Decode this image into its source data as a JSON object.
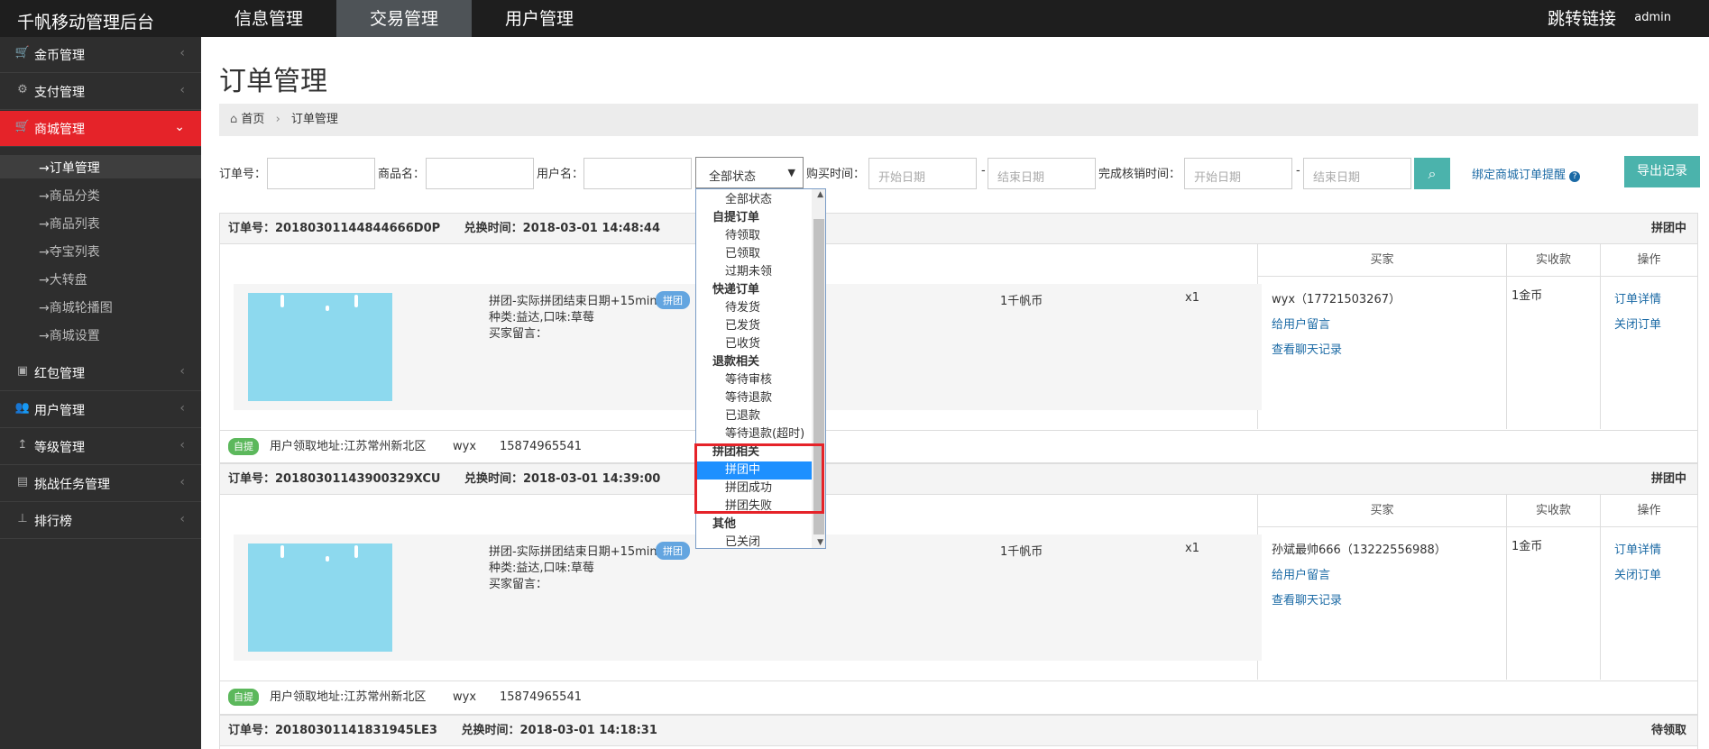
{
  "topbar": {
    "brand": "千帆移动管理后台",
    "nav": [
      "信息管理",
      "交易管理",
      "用户管理"
    ],
    "jump_link": "跳转链接",
    "user": "admin"
  },
  "sidebar": {
    "items": [
      {
        "label": "金币管理"
      },
      {
        "label": "支付管理"
      },
      {
        "label": "商城管理"
      },
      {
        "label": "红包管理"
      },
      {
        "label": "用户管理"
      },
      {
        "label": "等级管理"
      },
      {
        "label": "挑战任务管理"
      },
      {
        "label": "排行榜"
      }
    ],
    "sub_items": [
      "→订单管理",
      "→商品分类",
      "→商品列表",
      "→夺宝列表",
      "→大转盘",
      "→商城轮播图",
      "→商城设置"
    ]
  },
  "page": {
    "title": "订单管理",
    "breadcrumb_home": "首页",
    "breadcrumb_sep": "›",
    "breadcrumb_current": "订单管理"
  },
  "filters": {
    "order_no_label": "订单号：",
    "goods_label": "商品名：",
    "user_label": "用户名：",
    "status_value": "全部状态",
    "buy_time_label": "购买时间：",
    "start_placeholder": "开始日期",
    "end_placeholder": "结束日期",
    "dash": "-",
    "finish_time_label": "完成核销时间：",
    "bind_link": "绑定商城订单提醒",
    "export": "导出记录"
  },
  "dropdown": [
    {
      "type": "opt",
      "label": "全部状态"
    },
    {
      "type": "grp",
      "label": "自提订单"
    },
    {
      "type": "opt",
      "label": "待领取"
    },
    {
      "type": "opt",
      "label": "已领取"
    },
    {
      "type": "opt",
      "label": "过期未领"
    },
    {
      "type": "grp",
      "label": "快递订单"
    },
    {
      "type": "opt",
      "label": "待发货"
    },
    {
      "type": "opt",
      "label": "已发货"
    },
    {
      "type": "opt",
      "label": "已收货"
    },
    {
      "type": "grp",
      "label": "退款相关"
    },
    {
      "type": "opt",
      "label": "等待审核"
    },
    {
      "type": "opt",
      "label": "等待退款"
    },
    {
      "type": "opt",
      "label": "已退款"
    },
    {
      "type": "opt",
      "label": "等待退款(超时)"
    },
    {
      "type": "grp",
      "label": "拼团相关"
    },
    {
      "type": "opt",
      "label": "拼团中",
      "selected": true
    },
    {
      "type": "opt",
      "label": "拼团成功"
    },
    {
      "type": "opt",
      "label": "拼团失败"
    },
    {
      "type": "grp",
      "label": "其他"
    },
    {
      "type": "opt",
      "label": "已关闭"
    }
  ],
  "table_headers": {
    "buyer": "买家",
    "paid": "实收款",
    "ops": "操作"
  },
  "orders": [
    {
      "order_no": "订单号：20180301144844666D0P",
      "exchange_time": "兑换时间：2018-03-01 14:48:44",
      "status": "拼团中",
      "product_title": "拼团-实际拼团结束日期+15min",
      "badge": "拼团",
      "spec": "种类:益达,口味:草莓",
      "remark": "买家留言：",
      "price": "1千帆币",
      "qty": "x1",
      "buyer": "wyx（17721503267）",
      "msg_link": "给用户留言",
      "chat_link": "查看聊天记录",
      "paid": "1金币",
      "detail_link": "订单详情",
      "close_link": "关闭订单",
      "pickup_tag": "自提",
      "address": "用户领取地址:江苏常州新北区",
      "pickup_user": "wyx",
      "phone": "15874965541"
    },
    {
      "order_no": "订单号：20180301143900329XCU",
      "exchange_time": "兑换时间：2018-03-01 14:39:00",
      "status": "拼团中",
      "product_title": "拼团-实际拼团结束日期+15min",
      "badge": "拼团",
      "spec": "种类:益达,口味:草莓",
      "remark": "买家留言：",
      "price": "1千帆币",
      "qty": "x1",
      "buyer": "孙斌最帅666（13222556988）",
      "msg_link": "给用户留言",
      "chat_link": "查看聊天记录",
      "paid": "1金币",
      "detail_link": "订单详情",
      "close_link": "关闭订单",
      "pickup_tag": "自提",
      "address": "用户领取地址:江苏常州新北区",
      "pickup_user": "wyx",
      "phone": "15874965541"
    },
    {
      "order_no": "订单号：20180301141831945LE3",
      "exchange_time": "兑换时间：2018-03-01 14:18:31",
      "status": "待领取"
    }
  ]
}
